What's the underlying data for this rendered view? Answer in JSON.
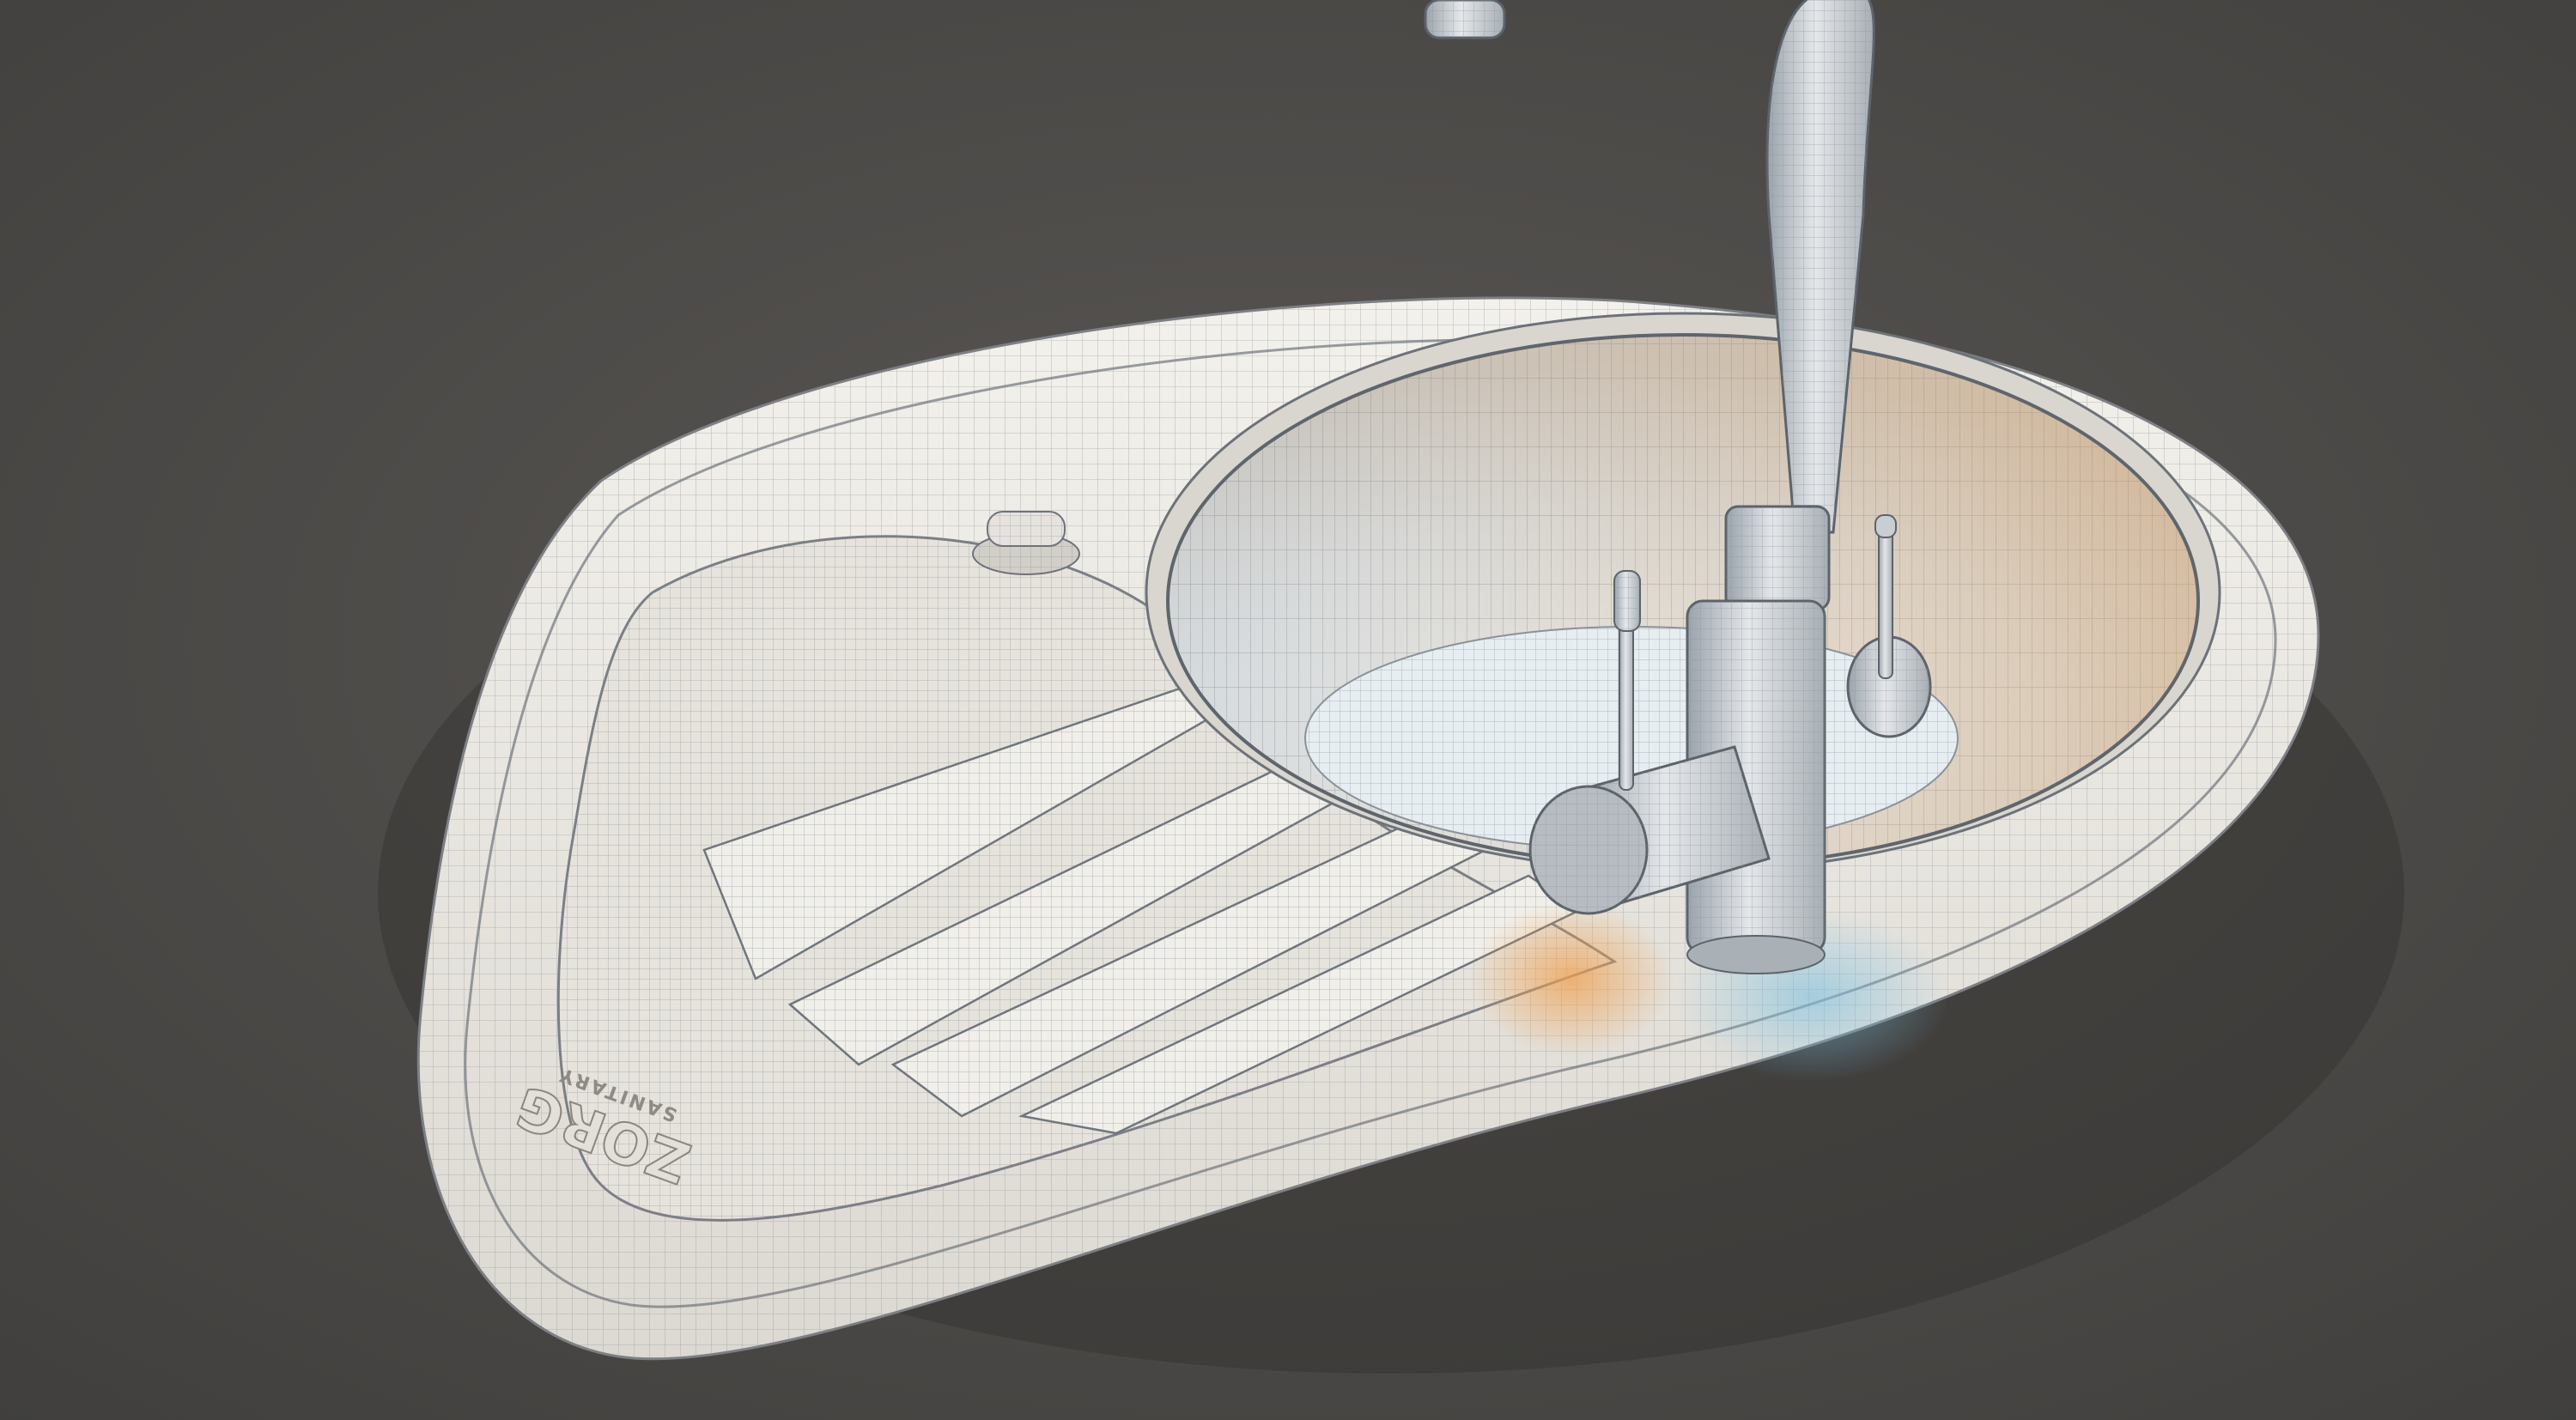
{
  "image": {
    "subject": "kitchen-sink-wireframe-render",
    "background_color": "#4f4d4a",
    "ceramic_color": "#ebe8e2",
    "wireframe_color": "#8c9299",
    "warm_accent_color": "#e8a45c",
    "cool_accent_color": "#8fc2dc"
  },
  "logo": {
    "brand": "ZORG",
    "sub": "SANITARY"
  }
}
